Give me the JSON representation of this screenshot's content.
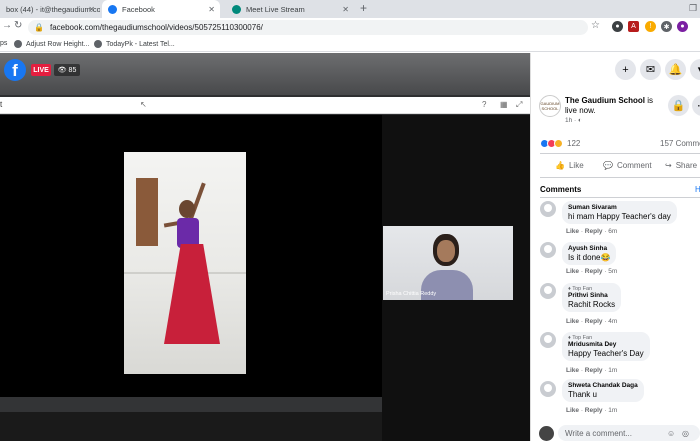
{
  "browser": {
    "tabs": [
      {
        "title": "box (44) - it@thegaudium.com",
        "icon_color": "#d93025",
        "active": false
      },
      {
        "title": "Facebook",
        "icon_color": "#1877f2",
        "active": true
      },
      {
        "title": "Meet Live Stream",
        "icon_color": "#00897b",
        "active": false
      }
    ],
    "url": "facebook.com/thegaudiumschool/videos/505725110300076/",
    "bookmarks": [
      "ps",
      "Adjust Row Height...",
      "TodayPk - Latest Tel..."
    ]
  },
  "video": {
    "live_label": "LIVE",
    "viewer_count": "85",
    "meet_header_text": "t",
    "participant_name": "Prisha Chittia Reddy"
  },
  "post": {
    "page_name": "The Gaudium School",
    "status_suffix": "is live now.",
    "time": "1h",
    "avatar_text": "GAUDIUM SCHOOL",
    "reaction_count": "122",
    "comment_count": "157 Comme",
    "actions": {
      "like": "Like",
      "comment": "Comment",
      "share": "Share"
    },
    "comments_header": "Comments",
    "comments_header_right": "H"
  },
  "comments": [
    {
      "name": "Suman Sivaram",
      "badge": "",
      "text": "hi mam Happy Teacher's day",
      "like": "Like",
      "reply": "Reply",
      "time": "6m"
    },
    {
      "name": "Ayush Sinha",
      "badge": "",
      "text": "Is it done😂",
      "like": "Like",
      "reply": "Reply",
      "time": "5m"
    },
    {
      "name": "Prithvi Sinha",
      "badge": "Top Fan",
      "text": "Rachit Rocks",
      "like": "Like",
      "reply": "Reply",
      "time": "4m"
    },
    {
      "name": "Mridusmita Dey",
      "badge": "Top Fan",
      "text": "Happy Teacher's Day",
      "like": "Like",
      "reply": "Reply",
      "time": "1m"
    },
    {
      "name": "Shweta Chandak Daga",
      "badge": "",
      "text": "Thank u",
      "like": "Like",
      "reply": "Reply",
      "time": "1m"
    }
  ],
  "composer": {
    "placeholder": "Write a comment..."
  },
  "colors": {
    "facebook_blue": "#1877f2",
    "live_red": "#e41e3f"
  }
}
